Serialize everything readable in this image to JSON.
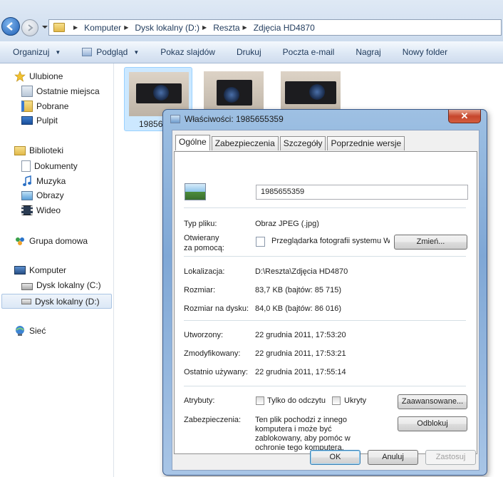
{
  "address_bar": {
    "crumbs": [
      "Komputer",
      "Dysk lokalny (D:)",
      "Reszta",
      "Zdjęcia HD4870"
    ]
  },
  "toolbar": {
    "organize": "Organizuj",
    "preview": "Podgląd",
    "slideshow": "Pokaz slajdów",
    "print": "Drukuj",
    "email": "Poczta e-mail",
    "burn": "Nagraj",
    "new_folder": "Nowy folder"
  },
  "nav": {
    "favorites": "Ulubione",
    "recent": "Ostatnie miejsca",
    "downloads": "Pobrane",
    "desktop": "Pulpit",
    "libraries": "Biblioteki",
    "documents": "Dokumenty",
    "music": "Muzyka",
    "pictures": "Obrazy",
    "videos": "Wideo",
    "homegroup": "Grupa domowa",
    "computer": "Komputer",
    "drive_c": "Dysk lokalny (C:)",
    "drive_d": "Dysk lokalny (D:)",
    "network": "Sieć"
  },
  "thumbnails": [
    {
      "caption": "19856"
    },
    {
      "caption": ""
    },
    {
      "caption": ""
    }
  ],
  "dialog": {
    "title": "Właściwości: 1985655359",
    "close": "✕",
    "tabs": [
      "Ogólne",
      "Zabezpieczenia",
      "Szczegóły",
      "Poprzednie wersje"
    ],
    "filename": "1985655359",
    "type_label": "Typ pliku:",
    "type_value": "Obraz JPEG (.jpg)",
    "opens_label_1": "Otwierany",
    "opens_label_2": "za pomocą:",
    "opens_value": "Przeglądarka fotografii systemu Wir",
    "change_btn": "Zmień...",
    "location_label": "Lokalizacja:",
    "location_value": "D:\\Reszta\\Zdjęcia HD4870",
    "size_label": "Rozmiar:",
    "size_value": "83,7 KB (bajtów: 85 715)",
    "size_disk_label": "Rozmiar na dysku:",
    "size_disk_value": "84,0 KB (bajtów: 86 016)",
    "created_label": "Utworzony:",
    "created_value": "22 grudnia 2011, 17:53:20",
    "modified_label": "Zmodyfikowany:",
    "modified_value": "22 grudnia 2011, 17:53:21",
    "accessed_label": "Ostatnio używany:",
    "accessed_value": "22 grudnia 2011, 17:55:14",
    "attributes_label": "Atrybuty:",
    "readonly_label": "Tylko do odczytu",
    "hidden_label": "Ukryty",
    "advanced_btn": "Zaawansowane...",
    "security_label": "Zabezpieczenia:",
    "security_text_1": "Ten plik pochodzi z innego",
    "security_text_2": "komputera i może być",
    "security_text_3": "zablokowany, aby pomóc w",
    "security_text_4": "ochronie tego komputera.",
    "unblock_btn": "Odblokuj",
    "ok_btn": "OK",
    "cancel_btn": "Anuluj",
    "apply_btn": "Zastosuj"
  }
}
